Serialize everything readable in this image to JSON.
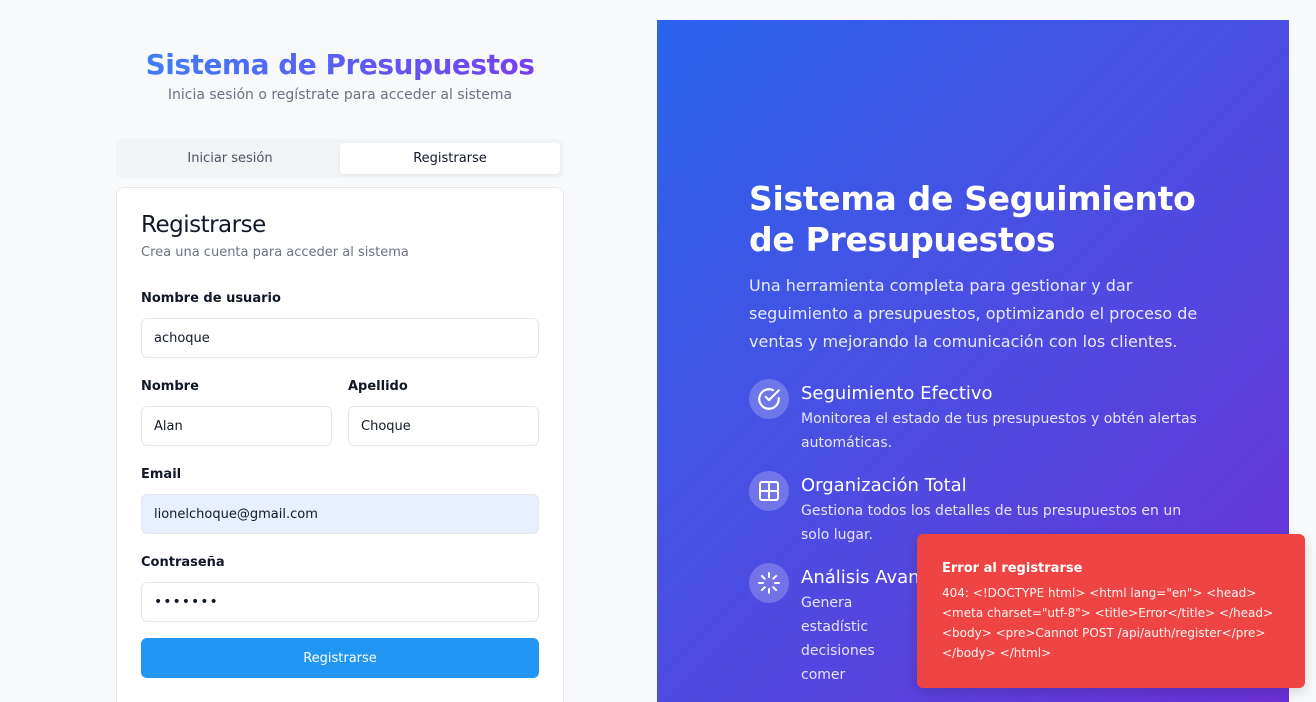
{
  "auth": {
    "title": "Sistema de Presupuestos",
    "subtitle": "Inicia sesión o regístrate para acceder al sistema",
    "tabs": [
      {
        "label": "Iniciar sesión",
        "active": false
      },
      {
        "label": "Registrarse",
        "active": true
      }
    ]
  },
  "form": {
    "title": "Registrarse",
    "subtitle": "Crea una cuenta para acceder al sistema",
    "username": {
      "label": "Nombre de usuario",
      "value": "achoque"
    },
    "first_name": {
      "label": "Nombre",
      "value": "Alan"
    },
    "last_name": {
      "label": "Apellido",
      "value": "Choque"
    },
    "email": {
      "label": "Email",
      "value": "lionelchoque@gmail.com"
    },
    "password": {
      "label": "Contraseña",
      "value": "•••••••"
    },
    "submit_label": "Registrarse",
    "submit_color": "#2196f3"
  },
  "hero": {
    "title": "Sistema de Seguimiento de Presupuestos",
    "description": "Una herramienta completa para gestionar y dar seguimiento a presupuestos, optimizando el proceso de ventas y mejorando la comunicación con los clientes.",
    "features": [
      {
        "icon": "check-circle-icon",
        "title": "Seguimiento Efectivo",
        "description": "Monitorea el estado de tus presupuestos y obtén alertas automáticas."
      },
      {
        "icon": "grid-icon",
        "title": "Organización Total",
        "description": "Gestiona todos los detalles de tus presupuestos en un solo lugar."
      },
      {
        "icon": "loader-icon",
        "title": "Análisis Avan",
        "description": "Genera estadístic decisiones comer"
      }
    ]
  },
  "toast": {
    "title": "Error al registrarse",
    "message": "404: <!DOCTYPE html> <html lang=\"en\"> <head> <meta charset=\"utf-8\"> <title>Error</title> </head> <body> <pre>Cannot POST /api/auth/register</pre> </body> </html>",
    "color": "#ef4444"
  }
}
